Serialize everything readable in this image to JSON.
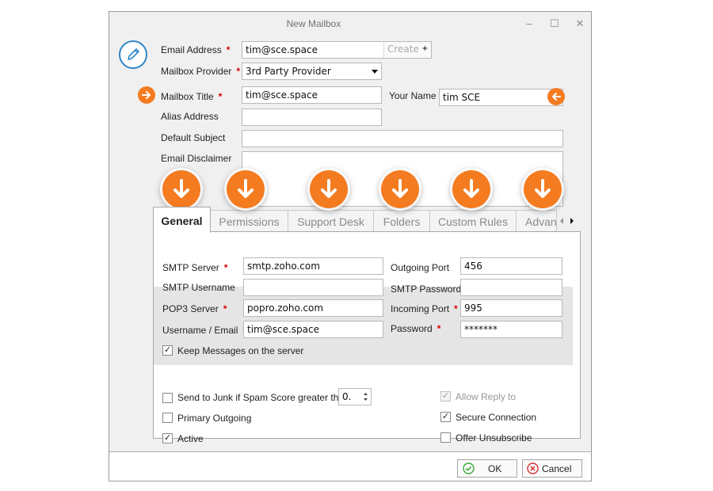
{
  "window": {
    "title": "New Mailbox",
    "minimize_glyph": "–",
    "maximize_glyph": "☐",
    "close_glyph": "✕"
  },
  "header_icon": "edit-pencil-icon",
  "form": {
    "email_address": {
      "label": "Email Address",
      "value": "tim@sce.space",
      "create_label": "Create"
    },
    "mailbox_provider": {
      "label": "Mailbox Provider",
      "value": "3rd Party Provider"
    },
    "mailbox_title": {
      "label": "Mailbox Title",
      "value": "tim@sce.space"
    },
    "your_name": {
      "label": "Your Name",
      "value": "tim SCE"
    },
    "alias_address": {
      "label": "Alias Address",
      "value": ""
    },
    "default_subject": {
      "label": "Default Subject",
      "value": ""
    },
    "email_disclaimer": {
      "label": "Email Disclaimer",
      "value": ""
    },
    "required_marker": "*"
  },
  "tabs": [
    {
      "label": "General",
      "active": true
    },
    {
      "label": "Permissions",
      "active": false
    },
    {
      "label": "Support Desk",
      "active": false
    },
    {
      "label": "Folders",
      "active": false
    },
    {
      "label": "Custom Rules",
      "active": false
    },
    {
      "label": "Advan",
      "active": false
    }
  ],
  "general": {
    "smtp_server": {
      "label": "SMTP Server",
      "value": "smtp.zoho.com"
    },
    "outgoing_port": {
      "label": "Outgoing Port",
      "value": "456"
    },
    "smtp_username": {
      "label": "SMTP Username",
      "value": ""
    },
    "smtp_password": {
      "label": "SMTP Password",
      "value": ""
    },
    "pop3_server": {
      "label": "POP3 Server",
      "value": "popro.zoho.com"
    },
    "incoming_port": {
      "label": "Incoming Port",
      "value": "995"
    },
    "username_email": {
      "label": "Username / Email",
      "value": "tim@sce.space"
    },
    "password": {
      "label": "Password",
      "value": "*******"
    },
    "keep_messages": {
      "label": "Keep Messages on the server",
      "checked": true
    },
    "send_to_junk": {
      "label": "Send to Junk if Spam Score greater than",
      "checked": false,
      "score": "0."
    },
    "primary_outgoing": {
      "label": "Primary Outgoing",
      "checked": false
    },
    "active": {
      "label": "Active",
      "checked": true
    },
    "allow_reply_to": {
      "label": "Allow Reply to",
      "checked": true,
      "disabled": true
    },
    "secure_connection": {
      "label": "Secure Connection",
      "checked": true
    },
    "offer_unsubscribe": {
      "label": "Offer Unsubscribe",
      "checked": false
    }
  },
  "footer": {
    "ok_label": "OK",
    "cancel_label": "Cancel"
  },
  "colors": {
    "accent_orange": "#f47b20",
    "icon_blue": "#2e86c9",
    "required_red": "#d80000",
    "ok_green": "#3aa83a",
    "cancel_red": "#d83030"
  }
}
